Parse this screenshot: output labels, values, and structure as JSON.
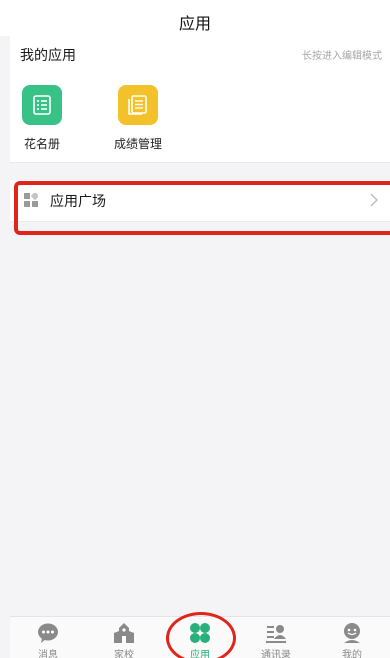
{
  "header": {
    "title": "应用"
  },
  "my_apps": {
    "title": "我的应用",
    "edit_hint": "长按进入编辑模式",
    "items": [
      {
        "label": "花名册",
        "icon": "roster-list-icon",
        "color": "#39c287"
      },
      {
        "label": "成绩管理",
        "icon": "grades-document-icon",
        "color": "#f3c22b"
      }
    ]
  },
  "market": {
    "label": "应用广场",
    "icon": "app-grid-icon",
    "arrow": "chevron-right-icon"
  },
  "tabbar": {
    "items": [
      {
        "label": "消息",
        "icon": "chat-bubble-icon",
        "active": false
      },
      {
        "label": "家校",
        "icon": "school-building-icon",
        "active": false
      },
      {
        "label": "应用",
        "icon": "four-leaf-apps-icon",
        "active": true
      },
      {
        "label": "通讯录",
        "icon": "contacts-icon",
        "active": false
      },
      {
        "label": "我的",
        "icon": "profile-icon",
        "active": false
      }
    ]
  },
  "colors": {
    "accent": "#27b07c",
    "highlight": "#e1251b",
    "inactive": "#8a8a8a"
  }
}
